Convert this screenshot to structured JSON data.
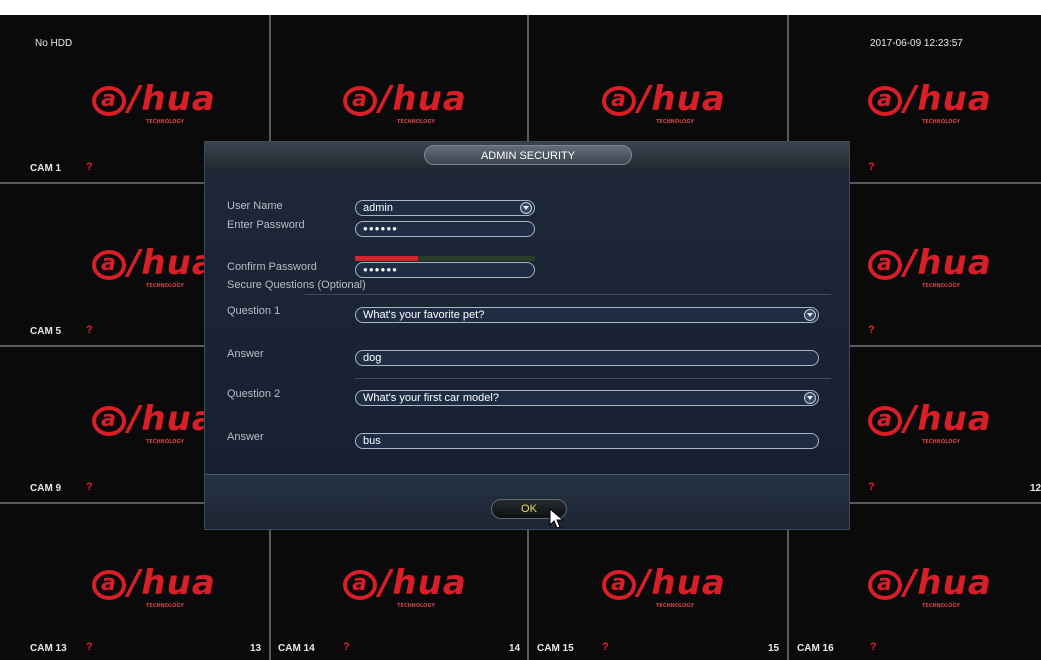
{
  "overlay": {
    "hdd_status": "No HDD",
    "datetime": "2017-06-09 12:23:57"
  },
  "logo": {
    "text": "a/hua",
    "tagline": "TECHNOLOGY",
    "color": "#d81e26"
  },
  "cameras": {
    "cam1": "CAM 1",
    "cam5": "CAM 5",
    "cam9": "CAM 9",
    "cam13": "CAM 13",
    "cam14": "CAM 14",
    "cam15": "CAM 15",
    "cam16": "CAM 16",
    "warning": "?",
    "num13": "13",
    "num14": "14",
    "num15": "15",
    "num12": "12"
  },
  "dialog": {
    "title": "ADMIN SECURITY",
    "user_name_label": "User Name",
    "user_name_value": "admin",
    "enter_password_label": "Enter Password",
    "enter_password_value": "●●●●●●",
    "password_strength": 0.35,
    "confirm_password_label": "Confirm Password",
    "confirm_password_value": "●●●●●●",
    "secure_questions_label": "Secure Questions (Optional)",
    "question1_label": "Question 1",
    "question1_value": "What's your favorite pet?",
    "answer1_label": "Answer",
    "answer1_value": "dog",
    "question2_label": "Question 2",
    "question2_value": "What's your first car model?",
    "answer2_label": "Answer",
    "answer2_value": "bus",
    "ok_label": "OK"
  }
}
